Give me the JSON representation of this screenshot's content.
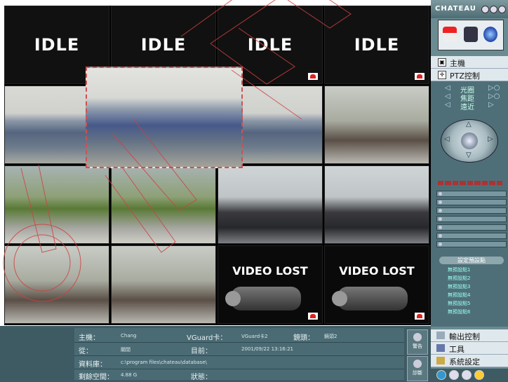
{
  "grid": {
    "idle_label": "IDLE",
    "lost_label": "VIDEO LOST"
  },
  "status": {
    "host_label": "主機：",
    "host_value": "Chang",
    "card_label": "VGuard卡：",
    "card_value": "VGuard卡2",
    "lens_label": "鏡頭：",
    "lens_value": "鏡頭2",
    "from_label": "從：",
    "from_value": "關閉",
    "now_label": "目前：",
    "now_value": "2001/09/22 13:16:21",
    "db_label": "資料庫：",
    "db_value": "c:\\program files\\chateau\\database\\",
    "space_label": "剩餘空間：",
    "space_value": "4.88 G",
    "state_label": "狀態："
  },
  "status_buttons": [
    "警告",
    "診斷"
  ],
  "right_panel": {
    "title": "CHATEAU",
    "menu_host": "主機",
    "menu_ptz": "PTZ控制",
    "ptz_iris": "光圈",
    "ptz_focus": "焦距",
    "ptz_zoom": "遠近",
    "preset_header": "設定預設點",
    "presets": [
      "無預設點1",
      "無預設點2",
      "無預設點3",
      "無預設點4",
      "無預設點5",
      "無預設點6"
    ],
    "output_control": "輸出控制",
    "tools": "工具",
    "system_settings": "系統設定"
  },
  "colors": {
    "panel": "#6a8b92",
    "status_bg": "#4b6b74",
    "accent_red": "#d22222"
  }
}
